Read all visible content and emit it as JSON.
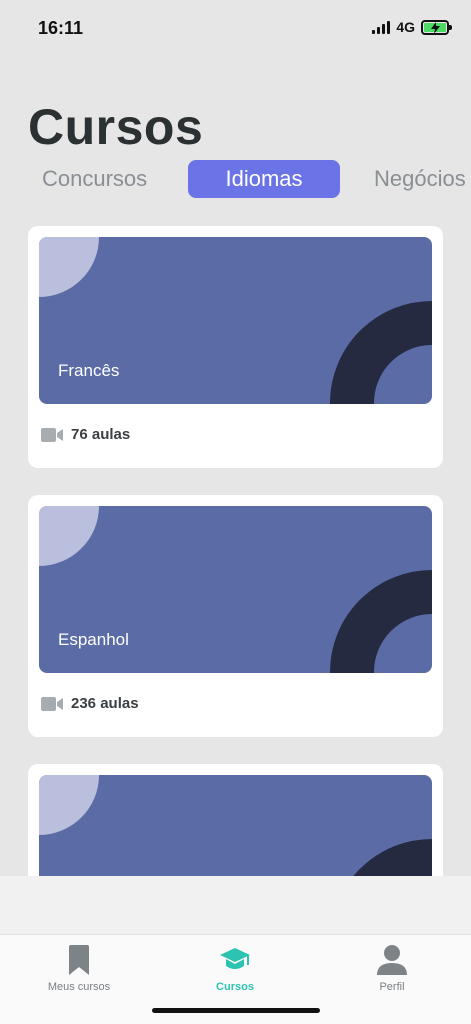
{
  "status_bar": {
    "time": "16:11",
    "network": "4G",
    "battery_color": "#4cd964"
  },
  "header": {
    "title": "Cursos"
  },
  "tabs": [
    {
      "label": "Concursos",
      "selected": false
    },
    {
      "label": "Idiomas",
      "selected": true
    },
    {
      "label": "Negócios",
      "selected": false
    }
  ],
  "courses": [
    {
      "name": "Francês",
      "lessons": "76 aulas",
      "icon": "video-camera-icon"
    },
    {
      "name": "Espanhol",
      "lessons": "236 aulas",
      "icon": "video-camera-icon"
    },
    {
      "name": "",
      "lessons": "",
      "icon": "video-camera-icon"
    }
  ],
  "bottom_nav": [
    {
      "label": "Meus cursos",
      "icon": "bookmark-icon",
      "active": false
    },
    {
      "label": "Cursos",
      "icon": "graduation-cap-icon",
      "active": true
    },
    {
      "label": "Perfil",
      "icon": "user-icon",
      "active": false
    }
  ],
  "colors": {
    "accent": "#6b74e6",
    "card_banner": "#5b6ba6",
    "active_nav": "#2cc3b0"
  }
}
